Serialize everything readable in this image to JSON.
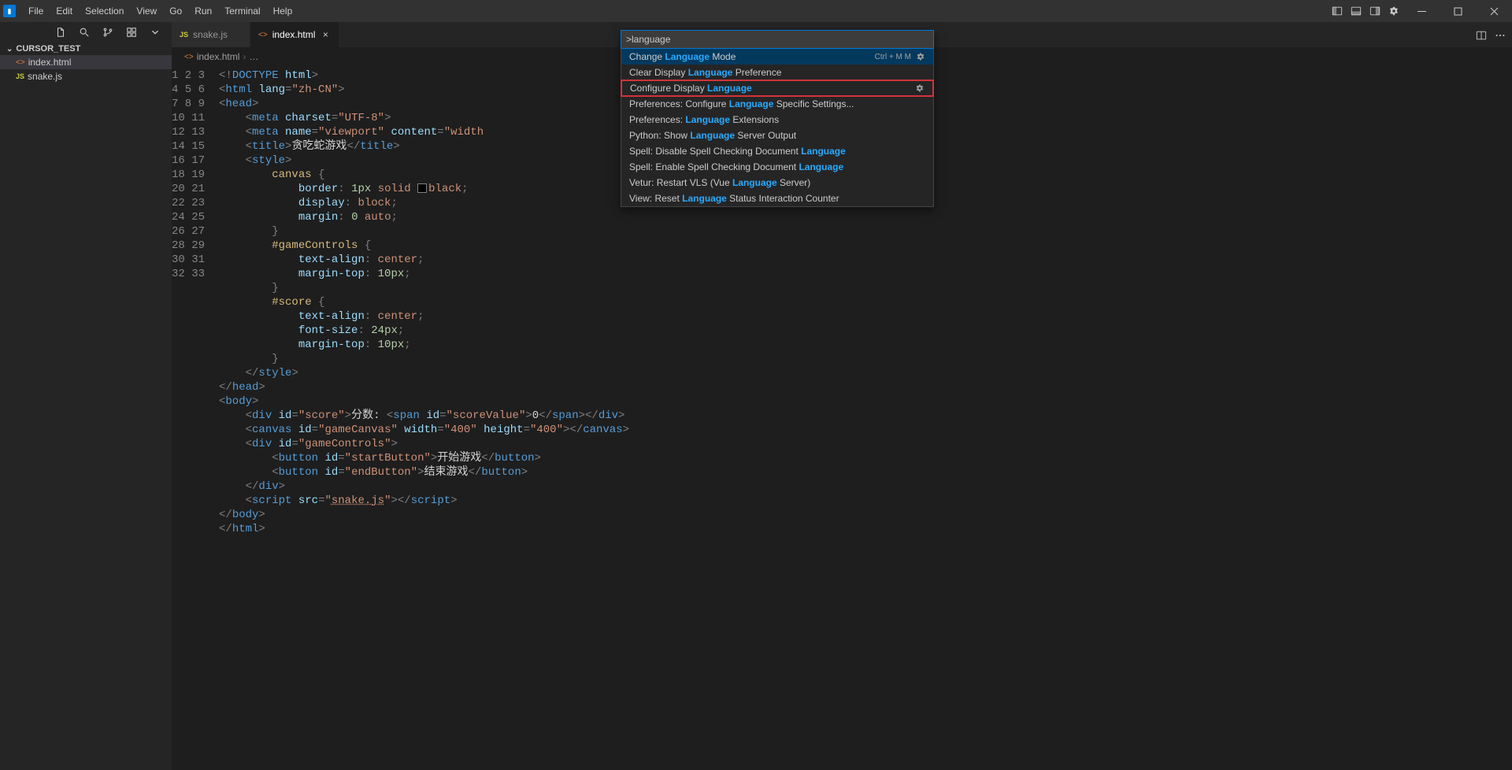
{
  "menubar": [
    "File",
    "Edit",
    "Selection",
    "View",
    "Go",
    "Run",
    "Terminal",
    "Help"
  ],
  "sidebar": {
    "folder": "CURSOR_TEST",
    "items": [
      {
        "icon": "html",
        "label": "index.html",
        "selected": true
      },
      {
        "icon": "js",
        "label": "snake.js",
        "selected": false
      }
    ]
  },
  "tabs": [
    {
      "icon": "js",
      "label": "snake.js",
      "active": false
    },
    {
      "icon": "html",
      "label": "index.html",
      "active": true
    }
  ],
  "breadcrumb": {
    "icon": "html",
    "file": "index.html",
    "sep1": "›",
    "ellipsis": "…"
  },
  "palette": {
    "input": ">language",
    "items": [
      {
        "pre": "Change ",
        "hl": "Language",
        "post": " Mode",
        "keys": "Ctrl  +   M    M",
        "gear": true,
        "selected": true
      },
      {
        "pre": "Clear Display ",
        "hl": "Language",
        "post": " Preference"
      },
      {
        "pre": "Configure Display ",
        "hl": "Language",
        "post": "",
        "gear": true,
        "highlighted": true
      },
      {
        "pre": "Preferences: Configure ",
        "hl": "Language",
        "post": " Specific Settings..."
      },
      {
        "pre": "Preferences: ",
        "hl": "Language",
        "post": " Extensions"
      },
      {
        "pre": "Python: Show ",
        "hl": "Language",
        "post": " Server Output"
      },
      {
        "pre": "Spell: Disable Spell Checking Document ",
        "hl": "Language",
        "post": ""
      },
      {
        "pre": "Spell: Enable Spell Checking Document ",
        "hl": "Language",
        "post": ""
      },
      {
        "pre": "Vetur: Restart VLS (Vue ",
        "hl": "Language",
        "post": " Server)"
      },
      {
        "pre": "View: Reset ",
        "hl": "Language",
        "post": " Status Interaction Counter"
      }
    ]
  },
  "code": {
    "lines": [
      {
        "n": 1,
        "html": "<span class='tok-punc'>&lt;!</span><span class='tok-tag'>DOCTYPE</span> <span class='tok-attr'>html</span><span class='tok-punc'>&gt;</span>"
      },
      {
        "n": 2,
        "html": "<span class='tok-punc'>&lt;</span><span class='tok-tag'>html</span> <span class='tok-attr'>lang</span><span class='tok-punc'>=</span><span class='tok-str'>\"zh-CN\"</span><span class='tok-punc'>&gt;</span>"
      },
      {
        "n": 3,
        "html": "<span class='tok-punc'>&lt;</span><span class='tok-tag'>head</span><span class='tok-punc'>&gt;</span>"
      },
      {
        "n": 4,
        "html": "    <span class='tok-punc'>&lt;</span><span class='tok-tag'>meta</span> <span class='tok-attr'>charset</span><span class='tok-punc'>=</span><span class='tok-str'>\"UTF-8\"</span><span class='tok-punc'>&gt;</span>"
      },
      {
        "n": 5,
        "html": "    <span class='tok-punc'>&lt;</span><span class='tok-tag'>meta</span> <span class='tok-attr'>name</span><span class='tok-punc'>=</span><span class='tok-str'>\"viewport\"</span> <span class='tok-attr'>content</span><span class='tok-punc'>=</span><span class='tok-str'>\"width</span>"
      },
      {
        "n": 6,
        "html": "    <span class='tok-punc'>&lt;</span><span class='tok-tag'>title</span><span class='tok-punc'>&gt;</span><span class='tok-text'>贪吃蛇游戏</span><span class='tok-punc'>&lt;/</span><span class='tok-tag'>title</span><span class='tok-punc'>&gt;</span>"
      },
      {
        "n": 7,
        "html": "    <span class='tok-punc'>&lt;</span><span class='tok-tag'>style</span><span class='tok-punc'>&gt;</span>"
      },
      {
        "n": 8,
        "html": "        <span class='tok-sel'>canvas</span> <span class='tok-punc'>{</span>"
      },
      {
        "n": 9,
        "html": "            <span class='tok-prop'>border</span><span class='tok-punc'>:</span> <span class='tok-num'>1px</span> <span class='tok-val'>solid</span> <span class='color-swatch'></span><span class='tok-val'>black</span><span class='tok-punc'>;</span>"
      },
      {
        "n": 10,
        "html": "            <span class='tok-prop'>display</span><span class='tok-punc'>:</span> <span class='tok-val'>block</span><span class='tok-punc'>;</span>"
      },
      {
        "n": 11,
        "html": "            <span class='tok-prop'>margin</span><span class='tok-punc'>:</span> <span class='tok-num'>0</span> <span class='tok-val'>auto</span><span class='tok-punc'>;</span>"
      },
      {
        "n": 12,
        "html": "        <span class='tok-punc'>}</span>"
      },
      {
        "n": 13,
        "html": "        <span class='tok-sel'>#gameControls</span> <span class='tok-punc'>{</span>"
      },
      {
        "n": 14,
        "html": "            <span class='tok-prop'>text-align</span><span class='tok-punc'>:</span> <span class='tok-val'>center</span><span class='tok-punc'>;</span>"
      },
      {
        "n": 15,
        "html": "            <span class='tok-prop'>margin-top</span><span class='tok-punc'>:</span> <span class='tok-num'>10px</span><span class='tok-punc'>;</span>"
      },
      {
        "n": 16,
        "html": "        <span class='tok-punc'>}</span>"
      },
      {
        "n": 17,
        "html": "        <span class='tok-sel'>#score</span> <span class='tok-punc'>{</span>"
      },
      {
        "n": 18,
        "html": "            <span class='tok-prop'>text-align</span><span class='tok-punc'>:</span> <span class='tok-val'>center</span><span class='tok-punc'>;</span>"
      },
      {
        "n": 19,
        "html": "            <span class='tok-prop'>font-size</span><span class='tok-punc'>:</span> <span class='tok-num'>24px</span><span class='tok-punc'>;</span>"
      },
      {
        "n": 20,
        "html": "            <span class='tok-prop'>margin-top</span><span class='tok-punc'>:</span> <span class='tok-num'>10px</span><span class='tok-punc'>;</span>"
      },
      {
        "n": 21,
        "html": "        <span class='tok-punc'>}</span>"
      },
      {
        "n": 22,
        "html": "    <span class='tok-punc'>&lt;/</span><span class='tok-tag'>style</span><span class='tok-punc'>&gt;</span>"
      },
      {
        "n": 23,
        "html": "<span class='tok-punc'>&lt;/</span><span class='tok-tag'>head</span><span class='tok-punc'>&gt;</span>"
      },
      {
        "n": 24,
        "html": "<span class='tok-punc'>&lt;</span><span class='tok-tag'>body</span><span class='tok-punc'>&gt;</span>"
      },
      {
        "n": 25,
        "html": "    <span class='tok-punc'>&lt;</span><span class='tok-tag'>div</span> <span class='tok-attr'>id</span><span class='tok-punc'>=</span><span class='tok-str'>\"score\"</span><span class='tok-punc'>&gt;</span><span class='tok-text'>分数: </span><span class='tok-punc'>&lt;</span><span class='tok-tag'>span</span> <span class='tok-attr'>id</span><span class='tok-punc'>=</span><span class='tok-str'>\"scoreValue\"</span><span class='tok-punc'>&gt;</span><span class='tok-text'>0</span><span class='tok-punc'>&lt;/</span><span class='tok-tag'>span</span><span class='tok-punc'>&gt;&lt;/</span><span class='tok-tag'>div</span><span class='tok-punc'>&gt;</span>"
      },
      {
        "n": 26,
        "html": "    <span class='tok-punc'>&lt;</span><span class='tok-tag'>canvas</span> <span class='tok-attr'>id</span><span class='tok-punc'>=</span><span class='tok-str'>\"gameCanvas\"</span> <span class='tok-attr'>width</span><span class='tok-punc'>=</span><span class='tok-str'>\"400\"</span> <span class='tok-attr'>height</span><span class='tok-punc'>=</span><span class='tok-str'>\"400\"</span><span class='tok-punc'>&gt;&lt;/</span><span class='tok-tag'>canvas</span><span class='tok-punc'>&gt;</span>"
      },
      {
        "n": 27,
        "html": "    <span class='tok-punc'>&lt;</span><span class='tok-tag'>div</span> <span class='tok-attr'>id</span><span class='tok-punc'>=</span><span class='tok-str'>\"gameControls\"</span><span class='tok-punc'>&gt;</span>"
      },
      {
        "n": 28,
        "html": "        <span class='tok-punc'>&lt;</span><span class='tok-tag'>button</span> <span class='tok-attr'>id</span><span class='tok-punc'>=</span><span class='tok-str'>\"startButton\"</span><span class='tok-punc'>&gt;</span><span class='tok-text'>开始游戏</span><span class='tok-punc'>&lt;/</span><span class='tok-tag'>button</span><span class='tok-punc'>&gt;</span>"
      },
      {
        "n": 29,
        "html": "        <span class='tok-punc'>&lt;</span><span class='tok-tag'>button</span> <span class='tok-attr'>id</span><span class='tok-punc'>=</span><span class='tok-str'>\"endButton\"</span><span class='tok-punc'>&gt;</span><span class='tok-text'>结束游戏</span><span class='tok-punc'>&lt;/</span><span class='tok-tag'>button</span><span class='tok-punc'>&gt;</span>"
      },
      {
        "n": 30,
        "html": "    <span class='tok-punc'>&lt;/</span><span class='tok-tag'>div</span><span class='tok-punc'>&gt;</span>"
      },
      {
        "n": 31,
        "html": "    <span class='tok-punc'>&lt;</span><span class='tok-tag'>script</span> <span class='tok-attr'>src</span><span class='tok-punc'>=</span><span class='tok-str'>\"</span><span class='tok-link'>snake.js</span><span class='tok-str'>\"</span><span class='tok-punc'>&gt;&lt;/</span><span class='tok-tag'>script</span><span class='tok-punc'>&gt;</span>"
      },
      {
        "n": 32,
        "html": "<span class='tok-punc'>&lt;/</span><span class='tok-tag'>body</span><span class='tok-punc'>&gt;</span>"
      },
      {
        "n": 33,
        "html": "<span class='tok-punc'>&lt;/</span><span class='tok-tag'>html</span><span class='tok-punc'>&gt;</span>"
      }
    ]
  }
}
